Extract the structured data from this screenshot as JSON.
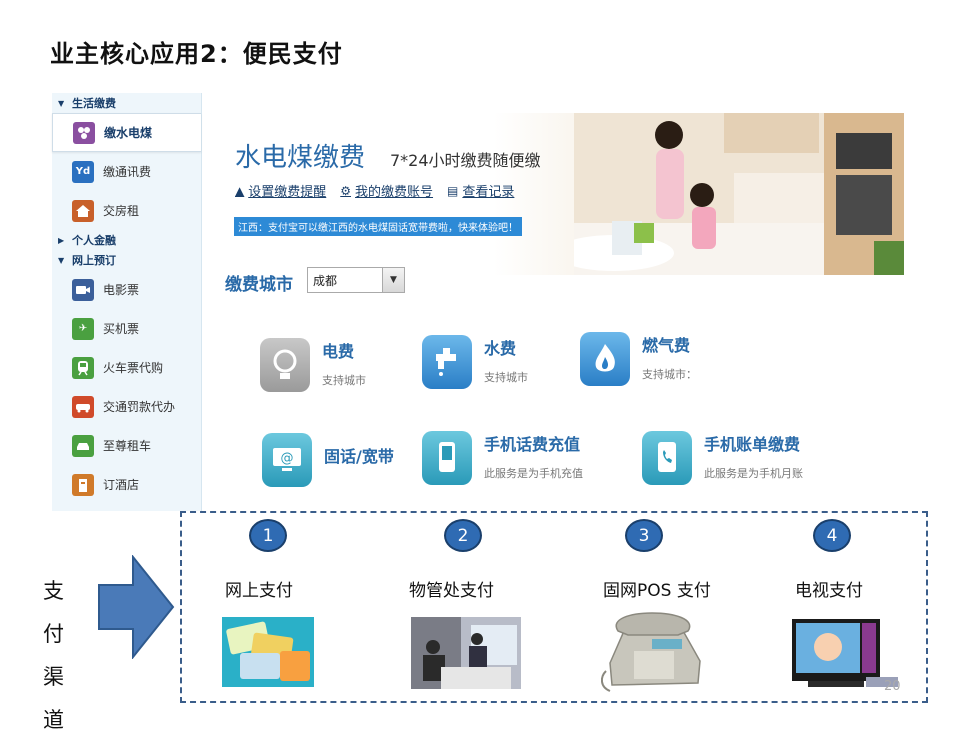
{
  "slide_title": "业主核心应用2：便民支付",
  "sidebar": {
    "sections": [
      {
        "label": "生活缴费",
        "arrow": "▼"
      },
      {
        "label": "个人金融",
        "arrow": "▶"
      },
      {
        "label": "网上预订",
        "arrow": "▼"
      }
    ],
    "items": [
      {
        "label": "缴水电煤",
        "icon": "utilities-icon",
        "color": "#8a4fa0"
      },
      {
        "label": "缴通讯费",
        "icon": "telecom-icon",
        "color": "#2a70c0",
        "glyph": "Yd"
      },
      {
        "label": "交房租",
        "icon": "house-rent-icon",
        "color": "#c8602a"
      },
      {
        "label": "电影票",
        "icon": "movie-icon",
        "color": "#3b5f9a"
      },
      {
        "label": "买机票",
        "icon": "plane-icon",
        "color": "#4aa040",
        "glyph": "✈"
      },
      {
        "label": "火车票代购",
        "icon": "train-icon",
        "color": "#4aa040"
      },
      {
        "label": "交通罚款代办",
        "icon": "traffic-fine-icon",
        "color": "#d04a2a"
      },
      {
        "label": "至尊租车",
        "icon": "car-icon",
        "color": "#4aa040"
      },
      {
        "label": "订酒店",
        "icon": "hotel-icon",
        "color": "#d07a2a"
      }
    ]
  },
  "main": {
    "title": "水电煤缴费",
    "subtitle": "7*24小时缴费随便缴",
    "links": [
      {
        "label": "设置缴费提醒",
        "icon": "bell-icon",
        "glyph": "🔔"
      },
      {
        "label": "我的缴费账号",
        "icon": "gear-icon",
        "glyph": "⚙"
      },
      {
        "label": "查看记录",
        "icon": "document-icon",
        "glyph": "▤"
      }
    ],
    "notice": "江西：支付宝可以缴江西的水电煤固话宽带费啦，快来体验吧！",
    "city_label": "缴费城市",
    "city_value": "成都",
    "services": [
      {
        "title": "电费",
        "desc": "支持城市"
      },
      {
        "title": "水费",
        "desc": "支持城市"
      },
      {
        "title": "燃气费",
        "desc": "支持城市："
      },
      {
        "title": "固话/宽带",
        "desc": ""
      },
      {
        "title": "手机话费充值",
        "desc": "此服务是为手机充值"
      },
      {
        "title": "手机账单缴费",
        "desc": "此服务是为手机月账"
      }
    ]
  },
  "channels": {
    "label": "支付渠道",
    "items": [
      {
        "num": "1",
        "label": "网上支付"
      },
      {
        "num": "2",
        "label": "物管处支付"
      },
      {
        "num": "3",
        "label": "固网POS 支付"
      },
      {
        "num": "4",
        "label": "电视支付"
      }
    ]
  },
  "page_number": "20"
}
